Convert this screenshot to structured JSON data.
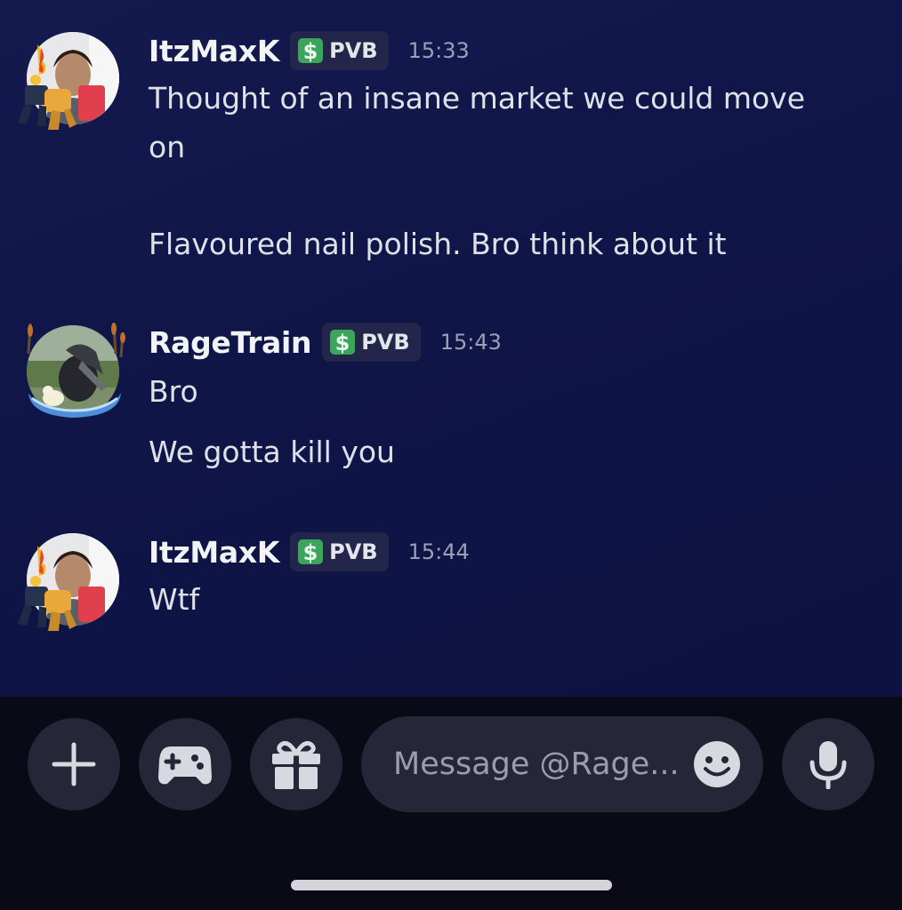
{
  "messages": [
    {
      "username": "ItzMaxK",
      "tag": "PVB",
      "time": "15:33",
      "lines": [
        "Thought of an insane market we could move",
        "on",
        "Flavoured nail polish. Bro think about it"
      ]
    },
    {
      "username": "RageTrain",
      "tag": "PVB",
      "time": "15:43",
      "lines": [
        "Bro",
        "We gotta kill you"
      ]
    },
    {
      "username": "ItzMaxK",
      "tag": "PVB",
      "time": "15:44",
      "lines": [
        "Wtf"
      ]
    }
  ],
  "composer": {
    "placeholder": "Message @Rage...",
    "buttons": {
      "add": "plus-icon",
      "games": "gamepad-icon",
      "gift": "gift-icon",
      "emoji": "emoji-icon",
      "voice": "microphone-icon"
    }
  },
  "colors": {
    "background_top": "#141a4e",
    "background_bottom": "#0d1242",
    "composer_bg": "#0a0a17",
    "button_bg": "#252637",
    "tag_bg": "#23264a",
    "tag_icon": "#3ba55c"
  }
}
